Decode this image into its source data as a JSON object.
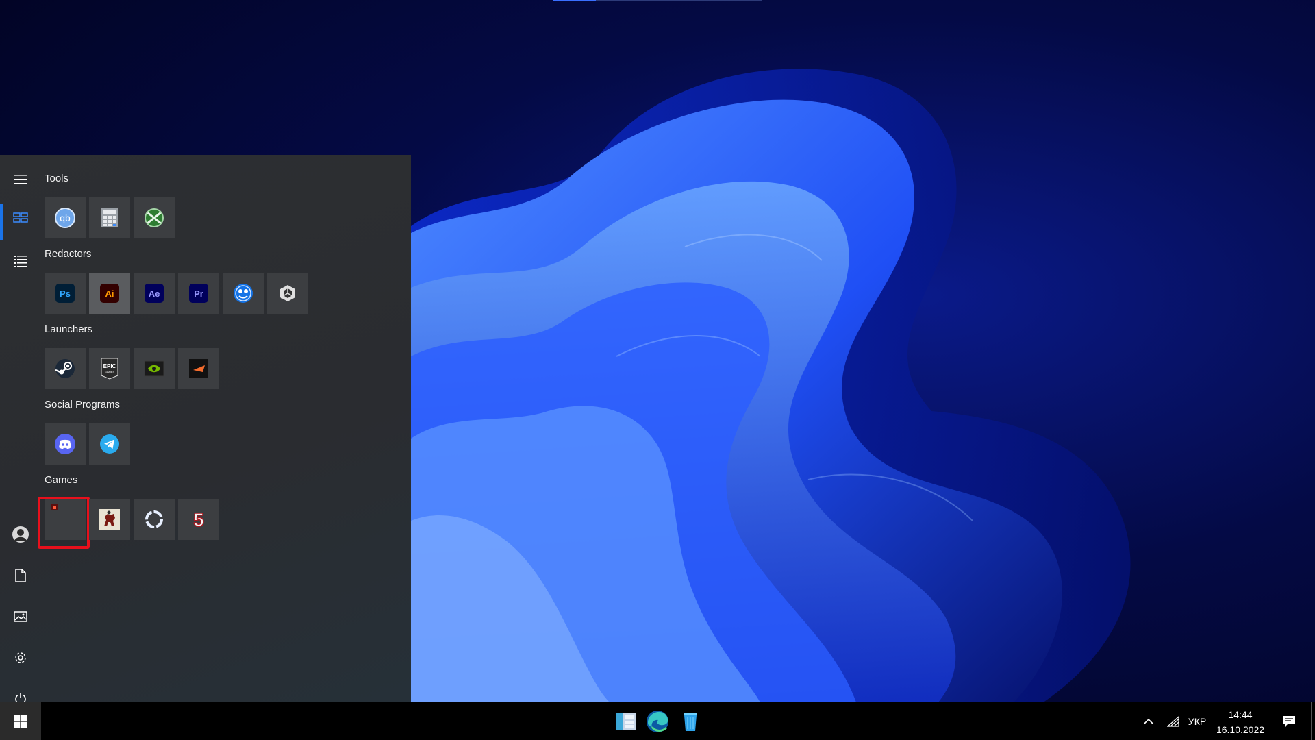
{
  "start_menu": {
    "groups": [
      {
        "title": "Tools",
        "tiles": [
          "qbittorrent",
          "calculator",
          "xbox-game-bar"
        ]
      },
      {
        "title": "Redactors",
        "tiles": [
          "Ps",
          "Ai",
          "Ae",
          "Pr",
          "creative-cloud",
          "unity"
        ]
      },
      {
        "title": "Launchers",
        "tiles": [
          "steam",
          "EPIC",
          "nvidia",
          "origin"
        ]
      },
      {
        "title": "Social Programs",
        "tiles": [
          "discord",
          "telegram"
        ]
      },
      {
        "title": "Games",
        "tiles": [
          "game-1",
          "red-dead-redemption",
          "ring-game",
          "5"
        ]
      }
    ],
    "tile_labels": {
      "ps": "Ps",
      "ai": "Ai",
      "ae": "Ae",
      "pr": "Pr",
      "epic_top": "EPIC",
      "epic_bottom": "GAMES",
      "game_five": "5"
    }
  },
  "taskbar": {
    "language": "УКР",
    "time": "14:44",
    "date": "16.10.2022"
  },
  "colors": {
    "menu_bg": "#2d2f32",
    "tile_bg": "#3c3e41",
    "accent": "#1a73e8",
    "highlight": "#e8101c"
  }
}
